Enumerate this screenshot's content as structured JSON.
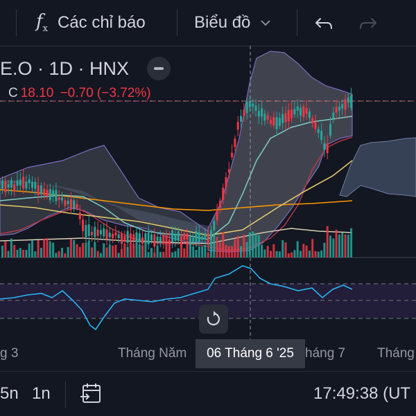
{
  "toolbar": {
    "indicators_label": "Các chỉ báo",
    "chart_label": "Biểu đồ",
    "indicators_icon": "function-fx-icon",
    "chart_type_icon": "chevron-down-icon",
    "undo_icon": "undo-icon",
    "redo_icon": "redo-icon"
  },
  "legend": {
    "symbol": "E.O · 1D · HNX",
    "close_label": "C",
    "close_value": "18.10",
    "change_value": "−0.70 (−3.72%)"
  },
  "time_axis": {
    "labels": [
      "g 3",
      "Tháng Năm",
      "háng 7",
      "Tháng"
    ],
    "crosshair_date": "06 Tháng 6 '25"
  },
  "bottombar": {
    "interval_1": "5n",
    "interval_2": "1n",
    "date_range_icon": "calendar-range-icon",
    "clock": "17:49:38 (UT"
  },
  "colors": {
    "up": "#26a69a",
    "down": "#f23645",
    "background": "#131722",
    "bollinger_fill": "#787b86",
    "cloud": "#5b6b8a",
    "ma_orange": "#ff9800",
    "ma_yellow": "#e3c96b",
    "ma_teal": "#80cbc4",
    "oscillator": "#29b6f6"
  }
}
